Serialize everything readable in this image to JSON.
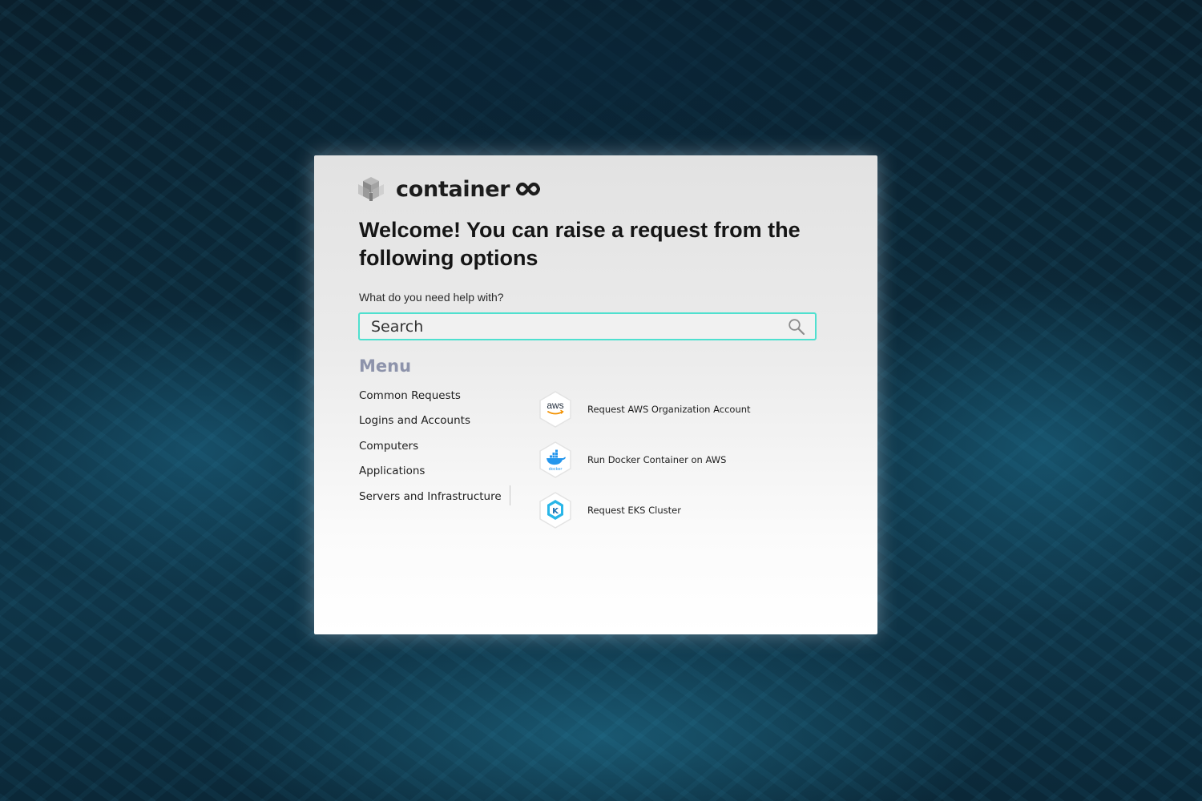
{
  "brand": {
    "name": "container",
    "logo_icon": "cube-stack-icon",
    "mark_icon": "infinity-icon"
  },
  "heading": "Welcome! You can raise a request from the following options",
  "search": {
    "label": "What do you need help with?",
    "placeholder": "Search",
    "value": "",
    "icon": "search-icon"
  },
  "menu": {
    "title": "Menu",
    "items": [
      {
        "label": "Common Requests"
      },
      {
        "label": "Logins and Accounts"
      },
      {
        "label": "Computers"
      },
      {
        "label": "Applications"
      },
      {
        "label": "Servers and Infrastructure"
      }
    ]
  },
  "options": [
    {
      "label": "Request AWS Organization Account",
      "icon": "aws-icon",
      "icon_text": "aws"
    },
    {
      "label": "Run Docker Container on AWS",
      "icon": "docker-icon",
      "icon_text": "docker"
    },
    {
      "label": "Request EKS Cluster",
      "icon": "eks-icon",
      "icon_text": "K"
    }
  ],
  "colors": {
    "search_border": "#4fe0cf",
    "menu_title": "#8d93ab",
    "aws_orange": "#f29100",
    "docker_blue": "#2496ed",
    "eks_blue": "#29b6e8"
  }
}
